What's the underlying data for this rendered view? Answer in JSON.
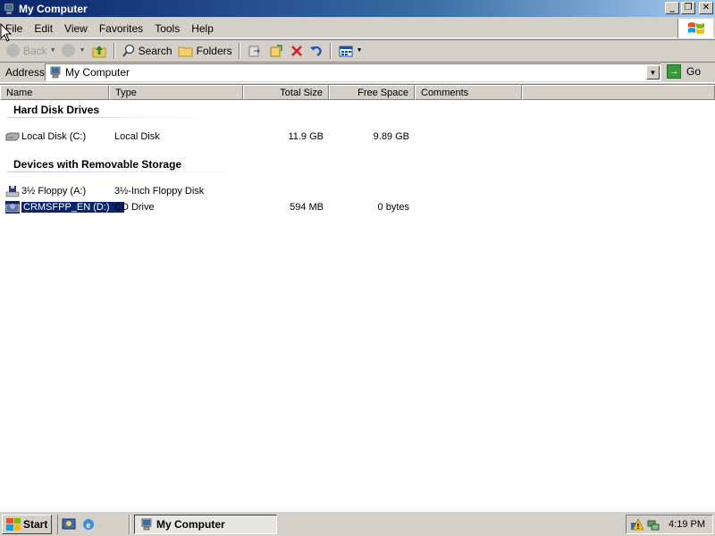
{
  "window": {
    "title": "My Computer"
  },
  "menu": {
    "items": [
      "File",
      "Edit",
      "View",
      "Favorites",
      "Tools",
      "Help"
    ]
  },
  "toolbar": {
    "back_label": "Back",
    "search_label": "Search",
    "folders_label": "Folders"
  },
  "address": {
    "label": "Address",
    "value": "My Computer",
    "go_label": "Go"
  },
  "columns": [
    "Name",
    "Type",
    "Total Size",
    "Free Space",
    "Comments"
  ],
  "groups": {
    "hard_disks": {
      "title": "Hard Disk Drives",
      "items": [
        {
          "name": "Local Disk (C:)",
          "type": "Local Disk",
          "total": "11.9 GB",
          "free": "9.89 GB"
        }
      ]
    },
    "removable": {
      "title": "Devices with Removable Storage",
      "items": [
        {
          "name": "3½ Floppy (A:)",
          "type": "3½-Inch Floppy Disk",
          "total": "",
          "free": ""
        },
        {
          "name": "CRMSFPP_EN (D:)",
          "type": "CD Drive",
          "total": "594 MB",
          "free": "0 bytes",
          "selected": true
        }
      ]
    }
  },
  "taskbar": {
    "start_label": "Start",
    "task_label": "My Computer",
    "clock": "4:19 PM"
  },
  "colors": {
    "titlebar_start": "#0a246a",
    "titlebar_end": "#a6caf0",
    "selection": "#0a246a",
    "face": "#d4d0c8"
  }
}
